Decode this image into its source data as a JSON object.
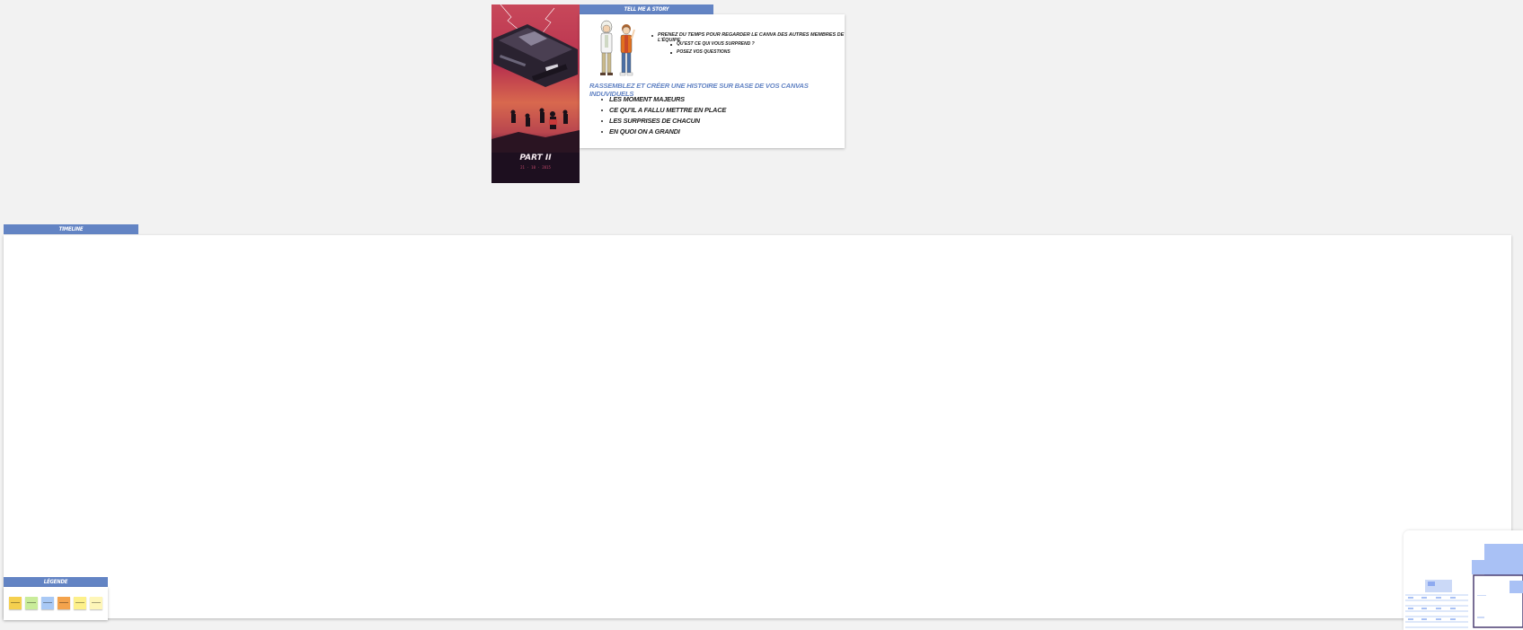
{
  "story_frame": {
    "tab_label": "Tell me a story",
    "bullet_main": "Prenez du temps pour regarder le canva des autres membres de l’équipe",
    "sub_bullets": [
      "Qu’est ce qui vous surprend ?",
      "Posez vos questions"
    ],
    "heading": "Rassemblez et créer une histoire sur base de vos canvas induviduels",
    "items": [
      "Les moment majeurs",
      "Ce qu’il a fallu mettre en place",
      "Les surprises de chacun",
      "En quoi on a grandi"
    ]
  },
  "poster": {
    "title": "PART II",
    "subtitle": "21 · 10 · 2015"
  },
  "timeline_frame": {
    "tab_label": "Timeline"
  },
  "legend_frame": {
    "tab_label": "Légende",
    "notes": [
      {
        "color": "#f5d04f"
      },
      {
        "color": "#c9ec9a"
      },
      {
        "color": "#a9c9f5"
      },
      {
        "color": "#f4a34c"
      },
      {
        "color": "#fdf08a"
      },
      {
        "color": "#fef6b8"
      }
    ]
  },
  "colors": {
    "frame_tab": "#6384c4",
    "canvas_bg": "#f2f2f2",
    "heading": "#6384c4"
  }
}
